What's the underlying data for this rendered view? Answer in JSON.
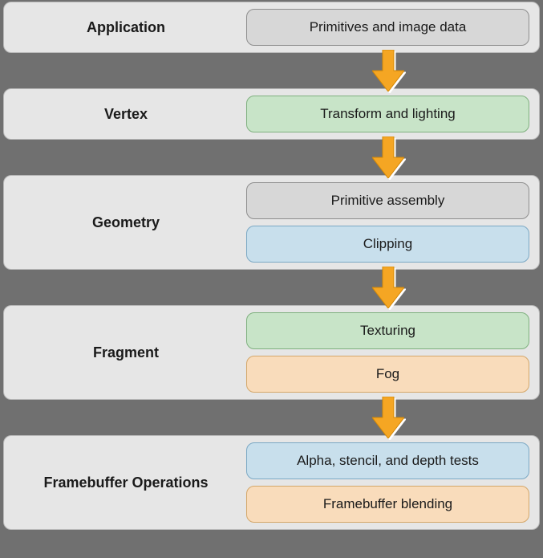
{
  "stages": [
    {
      "label": "Application",
      "boxes": [
        {
          "text": "Primitives and image data",
          "color": "gray"
        }
      ]
    },
    {
      "label": "Vertex",
      "boxes": [
        {
          "text": "Transform and lighting",
          "color": "green"
        }
      ]
    },
    {
      "label": "Geometry",
      "boxes": [
        {
          "text": "Primitive assembly",
          "color": "gray"
        },
        {
          "text": "Clipping",
          "color": "blue"
        }
      ]
    },
    {
      "label": "Fragment",
      "boxes": [
        {
          "text": "Texturing",
          "color": "green"
        },
        {
          "text": "Fog",
          "color": "peach"
        }
      ]
    },
    {
      "label": "Framebuffer Operations",
      "boxes": [
        {
          "text": "Alpha, stencil, and depth tests",
          "color": "blue"
        },
        {
          "text": "Framebuffer blending",
          "color": "peach"
        }
      ]
    }
  ]
}
